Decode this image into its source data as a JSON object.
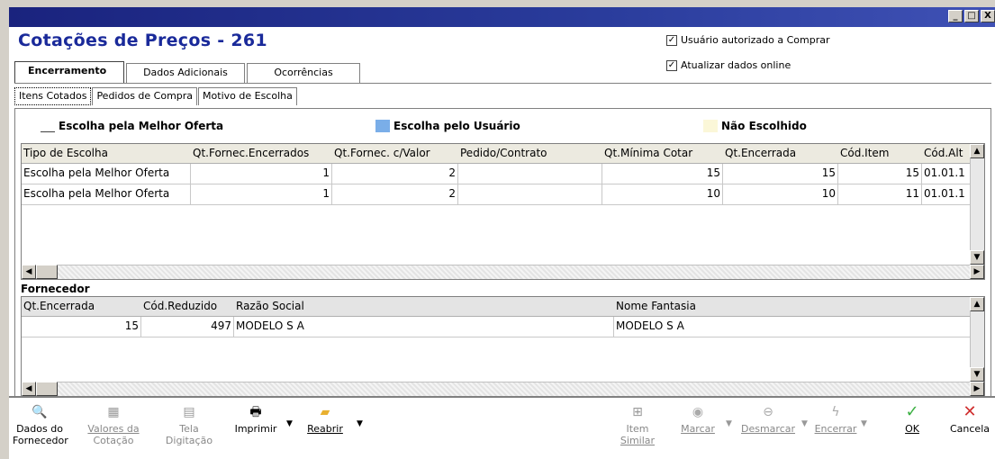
{
  "window": {
    "title": "Cotações de Preços - 261",
    "controls": [
      "_",
      "□",
      "X"
    ]
  },
  "checks": [
    {
      "label": "Usuário autorizado a Comprar",
      "checked": true
    },
    {
      "label": "Atualizar dados online",
      "checked": true
    }
  ],
  "tabs": [
    "Encerramento",
    "Dados Adicionais",
    "Ocorrências"
  ],
  "subtabs": [
    "Itens Cotados",
    "Pedidos de Compra",
    "Motivo de Escolha"
  ],
  "legend": [
    {
      "label": "Escolha pela Melhor Oferta",
      "color": "#ffffff"
    },
    {
      "label": "Escolha pelo Usuário",
      "color": "#7aaee8"
    },
    {
      "label": "Não Escolhido",
      "color": "#fbf7d8"
    }
  ],
  "items_table": {
    "columns": [
      "Tipo de Escolha",
      "Qt.Fornec.Encerrados",
      "Qt.Fornec. c/Valor",
      "Pedido/Contrato",
      "Qt.Mínima Cotar",
      "Qt.Encerrada",
      "Cód.Item",
      "Cód.Alt"
    ],
    "rows": [
      [
        "Escolha pela Melhor Oferta",
        "1",
        "2",
        "",
        "15",
        "15",
        "15",
        "01.01.1"
      ],
      [
        "Escolha pela Melhor Oferta",
        "1",
        "2",
        "",
        "10",
        "10",
        "11",
        "01.01.1"
      ]
    ]
  },
  "fornecedor": {
    "label": "Fornecedor",
    "columns": [
      "Qt.Encerrada",
      "Cód.Reduzido",
      "Razão Social",
      "Nome Fantasia"
    ],
    "rows": [
      [
        "15",
        "497",
        "MODELO S A",
        "MODELO S A"
      ]
    ]
  },
  "toolbar": {
    "dados_fornecedor": [
      "Dados do",
      "Fornecedor"
    ],
    "valores_cotacao": [
      "Valores da",
      "Cotação"
    ],
    "tela_digitacao": [
      "Tela",
      "Digitação"
    ],
    "imprimir": "Imprimir",
    "reabrir": "Reabrir",
    "item_similar": [
      "Item",
      "Similar"
    ],
    "marcar": "Marcar",
    "desmarcar": "Desmarcar",
    "encerrar": "Encerrar",
    "ok": "OK",
    "cancela": "Cancela"
  },
  "colors": {
    "titlebar": "#1a237e",
    "title_text": "#1a2a9a",
    "ok_icon": "#3cb043",
    "cancel_icon": "#d03030"
  }
}
